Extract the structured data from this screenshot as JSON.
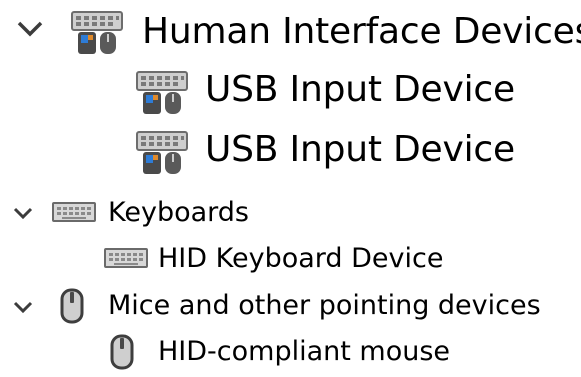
{
  "tree": {
    "human_interface_devices": {
      "label": "Human Interface Devices",
      "expanded": true,
      "icon": "hid-device-icon",
      "children": [
        {
          "label": "USB Input Device",
          "icon": "hid-device-icon"
        },
        {
          "label": "USB Input Device",
          "icon": "hid-device-icon"
        }
      ]
    },
    "keyboards": {
      "label": "Keyboards",
      "expanded": true,
      "icon": "keyboard-icon",
      "children": [
        {
          "label": "HID Keyboard Device",
          "icon": "keyboard-icon"
        }
      ]
    },
    "mice": {
      "label": "Mice and other pointing devices",
      "expanded": true,
      "icon": "mouse-icon",
      "children": [
        {
          "label": "HID-compliant mouse",
          "icon": "mouse-icon"
        }
      ]
    }
  },
  "colors": {
    "text": "#000000",
    "chevron": "#3c3c3c",
    "background": "#ffffff",
    "icon_gray": "#9a9a9a",
    "icon_accent_blue": "#2e7cd6",
    "icon_accent_orange": "#e08a2a"
  }
}
